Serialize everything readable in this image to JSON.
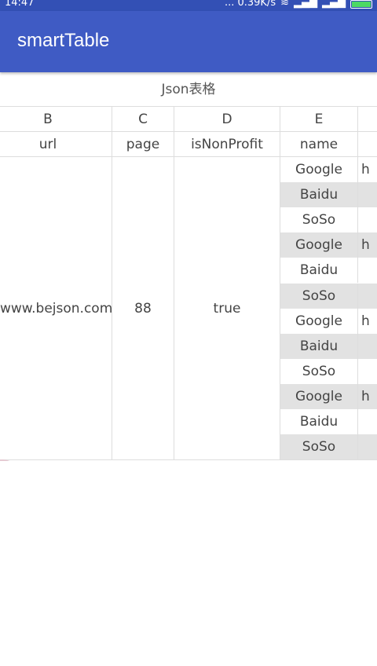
{
  "status_bar": {
    "time": "14:47",
    "network_speed": "... 0.39K/s",
    "icons": [
      "wifi-icon",
      "signal-icon",
      "signal-icon",
      "battery-icon"
    ]
  },
  "app_bar": {
    "title": "smartTable"
  },
  "table": {
    "title": "Json表格",
    "column_letters": [
      "B",
      "C",
      "D",
      "E"
    ],
    "column_headers": [
      "url",
      "page",
      "isNonProfit",
      "name"
    ],
    "merged_values": {
      "url": "www.bejson.com",
      "page": "88",
      "isNonProfit": "true"
    },
    "name_rows": [
      {
        "name": "Google",
        "extra": "h",
        "shaded": false
      },
      {
        "name": "Baidu",
        "extra": "",
        "shaded": true
      },
      {
        "name": "SoSo",
        "extra": "",
        "shaded": false
      },
      {
        "name": "Google",
        "extra": "h",
        "shaded": true
      },
      {
        "name": "Baidu",
        "extra": "",
        "shaded": false
      },
      {
        "name": "SoSo",
        "extra": "",
        "shaded": true
      },
      {
        "name": "Google",
        "extra": "h",
        "shaded": false
      },
      {
        "name": "Baidu",
        "extra": "",
        "shaded": true
      },
      {
        "name": "SoSo",
        "extra": "",
        "shaded": false
      },
      {
        "name": "Google",
        "extra": "h",
        "shaded": true
      },
      {
        "name": "Baidu",
        "extra": "",
        "shaded": false
      },
      {
        "name": "SoSo",
        "extra": "",
        "shaded": true
      }
    ]
  },
  "gif_badge": "gif",
  "colors": {
    "status_bar": "#3350b5",
    "app_bar": "#3f5bc4",
    "row_shade": "#e2e2e2",
    "grid_line": "#dddddd",
    "text": "#444444"
  }
}
